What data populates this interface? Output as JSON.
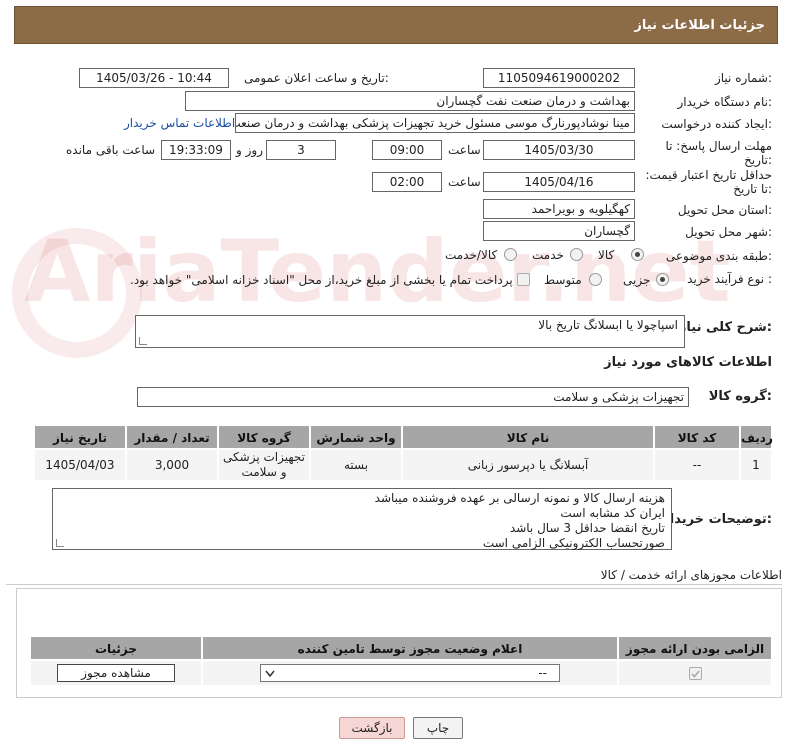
{
  "header": {
    "title": "جزئیات اطلاعات نیاز"
  },
  "form": {
    "need_number_label": "شماره نیاز:",
    "need_number": "1105094619000202",
    "announce_label": "تاریخ و ساعت اعلان عمومی:",
    "announce_value": "1405/03/26 - 10:44",
    "buyer_org_label": "نام دستگاه خریدار:",
    "buyer_org": "بهداشت و درمان صنعت نفت گچساران",
    "requester_label": "ایجاد کننده درخواست:",
    "requester": "مینا نوشادپورنارگ موسی مسئول خرید تجهیزات پزشکی  بهداشت و درمان صنعت نفت گچساران",
    "contact_link": "اطلاعات تماس خریدار",
    "reply_deadline_label": "مهلت ارسال پاسخ: تا تاریخ:",
    "reply_date": "1405/03/30",
    "time_label": "ساعت",
    "reply_time": "09:00",
    "days_count": "3",
    "days_label": "روز و",
    "remaining_time": "19:33:09",
    "remaining_label": "ساعت باقی مانده",
    "price_deadline_label": "حداقل تاریخ اعتبار قیمت: تا تاریخ:",
    "price_date": "1405/04/16",
    "price_time": "02:00",
    "province_label": "استان محل تحویل:",
    "province": "کهگیلویه و بویراحمد",
    "city_label": "شهر محل تحویل:",
    "city": "گچساران",
    "category_label": "طبقه بندی موضوعی:",
    "category_options": [
      "کالا",
      "خدمت",
      "کالا/خدمت"
    ],
    "process_label": "نوع فرآیند خرید :",
    "process_options": [
      "جزیی",
      "متوسط"
    ],
    "payment_note": "پرداخت تمام یا بخشی از مبلغ خرید،از محل \"اسناد خزانه اسلامی\" خواهد بود."
  },
  "description": {
    "label": "شرح کلی نیاز:",
    "value": "اسپاچولا یا ابسلانگ  تاریخ بالا"
  },
  "goods": {
    "section_title": "اطلاعات کالاهای مورد نیاز",
    "group_label": "گروه کالا:",
    "group_value": "تجهیزات پزشکی و سلامت",
    "columns": [
      "ردیف",
      "کد کالا",
      "نام کالا",
      "واحد شمارش",
      "گروه کالا",
      "تعداد / مقدار",
      "تاریخ نیاز"
    ],
    "rows": [
      {
        "row": "1",
        "code": "--",
        "name": "آبسلانگ یا دپرسور زبانی",
        "unit": "بسته",
        "group": "تجهیزات پزشکی و سلامت",
        "qty": "3,000",
        "date": "1405/04/03"
      }
    ]
  },
  "buyer_notes": {
    "label": "توضیحات خریدار:",
    "lines": [
      "هزینه ارسال کالا و نمونه ارسالی بر عهده فروشنده میباشد",
      "ایران کد مشابه است",
      "تاریخ انقضا حداقل 3 سال باشد",
      "صورتحساب الکترونیکی الزامی است"
    ]
  },
  "permits": {
    "section_title": "اطلاعات مجوزهای ارائه خدمت / کالا",
    "columns": [
      "الزامی بودن ارائه مجوز",
      "اعلام وضعیت مجوز توسط تامین کننده",
      "جزئیات"
    ],
    "select_value": "--",
    "view_button": "مشاهده مجوز"
  },
  "footer": {
    "print_button": "چاپ",
    "back_button": "بازگشت"
  },
  "watermark": "AriaTender.net",
  "colors": {
    "header_bg": "#8c6b47",
    "table_head_bg": "#a6a6a6",
    "back_button_bg": "#f7d6d6"
  }
}
